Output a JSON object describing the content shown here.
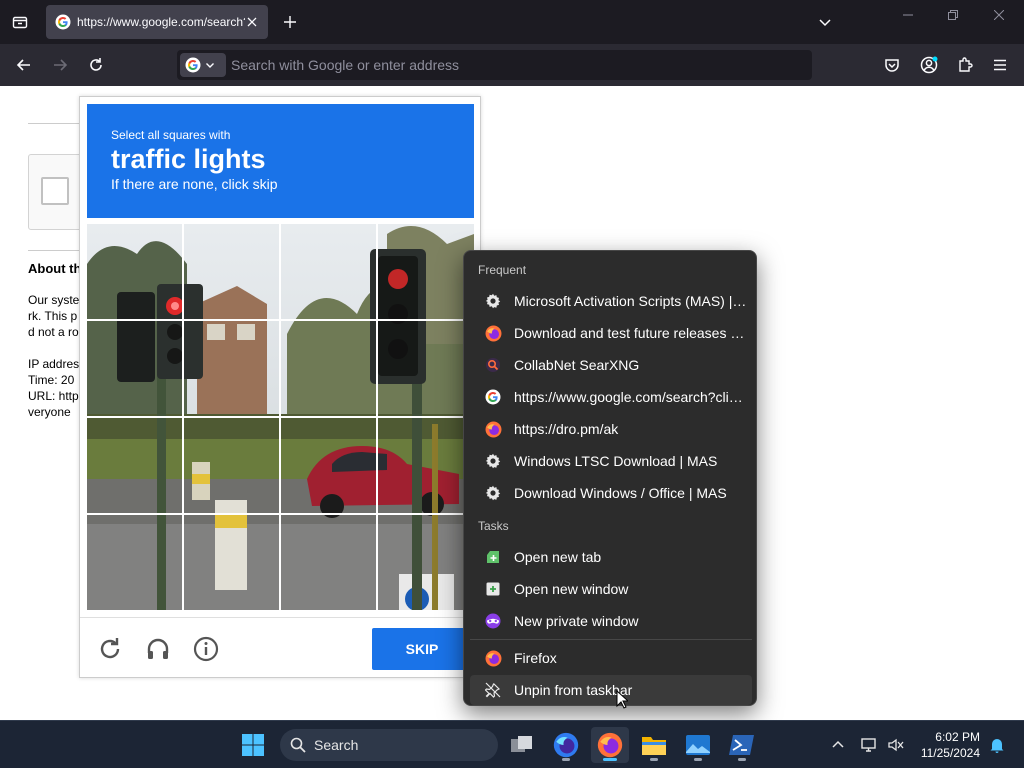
{
  "browser": {
    "tab": {
      "title": "https://www.google.com/search?client=firefox-b-d&q=test",
      "favicon": "google-g-icon"
    },
    "urlbar": {
      "placeholder": "Search with Google or enter address",
      "engine_icon": "google-g-icon"
    }
  },
  "page": {
    "about_heading": "About th",
    "lines": [
      "Our syste",
      "rk. This p",
      "d not a ro",
      "IP addres",
      "Time: 20",
      "URL: http",
      "veryone"
    ]
  },
  "captcha": {
    "intro": "Select all squares with",
    "target": "traffic lights",
    "subtitle": "If there are none, click skip",
    "skip_label": "SKIP",
    "accent": "#1a73e8",
    "icons": [
      "reload-icon",
      "headphones-icon",
      "info-icon"
    ]
  },
  "jumplist": {
    "frequent_heading": "Frequent",
    "frequent": [
      {
        "label": "Microsoft Activation Scripts (MAS) | MAS",
        "icon": "gear-icon"
      },
      {
        "label": "Download and test future releases of Firefox",
        "icon": "firefox-icon"
      },
      {
        "label": "CollabNet SearXNG",
        "icon": "searxng-icon"
      },
      {
        "label": "https://www.google.com/search?client=firefox",
        "icon": "google-g-icon"
      },
      {
        "label": "https://dro.pm/ak",
        "icon": "firefox-icon"
      },
      {
        "label": "Windows LTSC Download | MAS",
        "icon": "gear-icon"
      },
      {
        "label": "Download Windows / Office | MAS",
        "icon": "gear-icon"
      }
    ],
    "tasks_heading": "Tasks",
    "tasks": [
      {
        "label": "Open new tab",
        "icon": "new-tab-icon"
      },
      {
        "label": "Open new window",
        "icon": "new-window-icon"
      },
      {
        "label": "New private window",
        "icon": "private-mask-icon"
      }
    ],
    "app": {
      "label": "Firefox",
      "icon": "firefox-icon"
    },
    "unpin": {
      "label": "Unpin from taskbar",
      "icon": "unpin-icon"
    }
  },
  "taskbar": {
    "search_label": "Search",
    "time": "6:02 PM",
    "date": "11/25/2024",
    "accent": "#4cc2ff"
  }
}
